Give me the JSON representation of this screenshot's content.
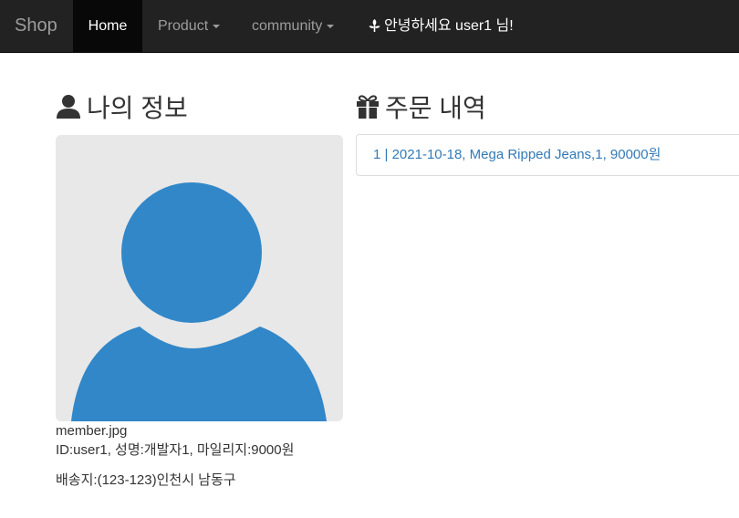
{
  "navbar": {
    "brand": "Shop",
    "items": [
      {
        "label": "Home"
      },
      {
        "label": "Product"
      },
      {
        "label": "community"
      }
    ],
    "greeting": "안녕하세요 user1 님!"
  },
  "profile": {
    "title": "나의 정보",
    "image_caption": "member.jpg",
    "details": "ID:user1, 성명:개발자1, 마일리지:9000원",
    "address": "배송지:(123-123)인천시 남동구"
  },
  "orders": {
    "title": "주문 내역",
    "items": [
      {
        "text": "1  | 2021-10-18, Mega Ripped Jeans,1, 90000원"
      }
    ]
  },
  "colors": {
    "navbar_bg": "#222222",
    "link": "#337ab7",
    "avatar": "#3287c8",
    "avatar_bg": "#e8e8e8"
  },
  "icons": {
    "profile": "user-icon",
    "orders": "gift-icon",
    "greeting": "leaf-icon"
  }
}
